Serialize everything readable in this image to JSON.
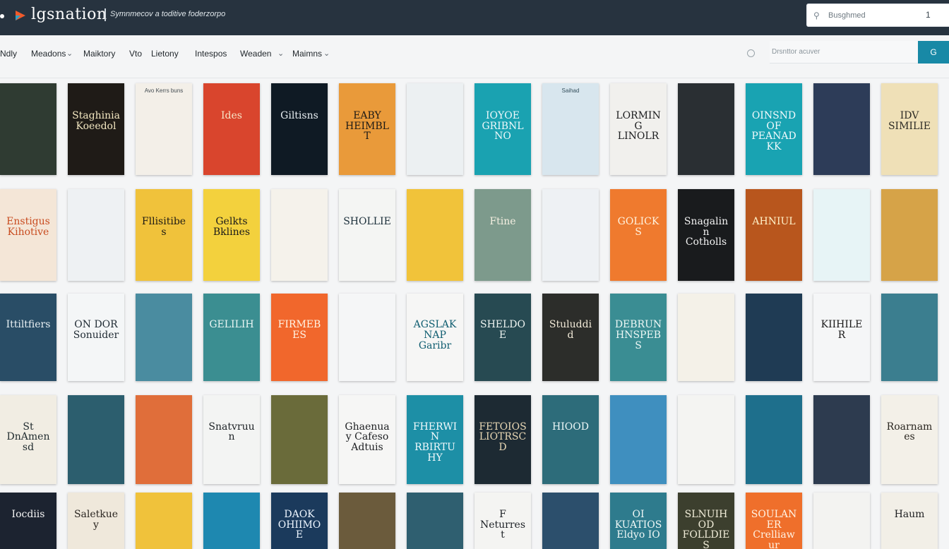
{
  "header": {
    "app_name": "lgsnation",
    "tagline": "Symnmecov a toditive foderzorpo",
    "search_text": "Busghmed",
    "search_count": "1",
    "colors": {
      "bar": "#27333f",
      "accent": "#1889a6"
    }
  },
  "nav": {
    "items": [
      "Ndly",
      "Meadons",
      "Maiktory",
      "Vto",
      "Lietony",
      "Intespos",
      "Weaden",
      "Maimns"
    ],
    "search_placeholder": "Drsnttor acuver",
    "search_button": "G"
  },
  "books": [
    {
      "top": "",
      "title": "",
      "bottom": "",
      "bg": "#2f3b32",
      "fg": "#e8e2c9"
    },
    {
      "top": "",
      "title": "Staghinia Koeedol",
      "bottom": "",
      "bg": "#1f1b17",
      "fg": "#f3e7c1"
    },
    {
      "top": "Avo Kerrs buns",
      "title": "",
      "bottom": "",
      "bg": "#f3efe8",
      "fg": "#1f2a33"
    },
    {
      "top": "",
      "title": "Ides",
      "bottom": "",
      "bg": "#d9452d",
      "fg": "#f7e6c8"
    },
    {
      "top": "",
      "title": "Giltisns",
      "bottom": "",
      "bg": "#0f1a24",
      "fg": "#e8eef2"
    },
    {
      "top": "",
      "title": "EABY HEIMBLT",
      "bottom": "",
      "bg": "#e99a3a",
      "fg": "#1d1a16"
    },
    {
      "top": "",
      "title": "",
      "bottom": "",
      "bg": "#ecf0f2",
      "fg": "#1f2b35"
    },
    {
      "top": "",
      "title": "IOYOE GRIBNLNO",
      "bottom": "",
      "bg": "#1aa2b1",
      "fg": "#eef8fa"
    },
    {
      "top": "Saihad",
      "title": "",
      "bottom": "",
      "bg": "#d8e6ee",
      "fg": "#13303e"
    },
    {
      "top": "",
      "title": "LORMING LINOLR",
      "bottom": "",
      "bg": "#f1f0ed",
      "fg": "#1b1c1e"
    },
    {
      "top": "",
      "title": "",
      "bottom": "",
      "bg": "#2a2f33",
      "fg": "#f0f0f0"
    },
    {
      "top": "",
      "title": "OINSND OF PEANADKK",
      "bottom": "",
      "bg": "#19a3b2",
      "fg": "#f2fafc"
    },
    {
      "top": "",
      "title": "",
      "bottom": "",
      "bg": "#2d3c58",
      "fg": "#f7d9a2"
    },
    {
      "top": "",
      "title": "IDV SIMILIE",
      "bottom": "",
      "bg": "#efe0b7",
      "fg": "#2c2a24"
    },
    {
      "top": "",
      "title": "Enstigus Kihotive",
      "bottom": "",
      "bg": "#f4e6d7",
      "fg": "#c84b1f"
    },
    {
      "top": "",
      "title": "",
      "bottom": "",
      "bg": "#eef1f3",
      "fg": "#1d2a33"
    },
    {
      "top": "",
      "title": "Fllisitibes",
      "bottom": "",
      "bg": "#f0c23b",
      "fg": "#1e1b14"
    },
    {
      "top": "",
      "title": "Gelkts Bklines",
      "bottom": "",
      "bg": "#f3d13d",
      "fg": "#1a1a1a"
    },
    {
      "top": "",
      "title": "",
      "bottom": "",
      "bg": "#f5f2eb",
      "fg": "#1d2833"
    },
    {
      "top": "",
      "title": "SHOLLIE",
      "bottom": "",
      "bg": "#f4f5f3",
      "fg": "#1a2e39"
    },
    {
      "top": "",
      "title": "",
      "bottom": "",
      "bg": "#f1c33a",
      "fg": "#1e2023"
    },
    {
      "top": "",
      "title": "Ftine",
      "bottom": "",
      "bg": "#7d9a8c",
      "fg": "#f6f0e2"
    },
    {
      "top": "",
      "title": "",
      "bottom": "",
      "bg": "#eef1f4",
      "fg": "#1d2a33"
    },
    {
      "top": "",
      "title": "GOLICKS",
      "bottom": "",
      "bg": "#ef7a2e",
      "fg": "#fff4e0"
    },
    {
      "top": "",
      "title": "Snagalinn Cotholls",
      "bottom": "",
      "bg": "#191b1d",
      "fg": "#f2f2f2"
    },
    {
      "top": "",
      "title": "AHNIUL",
      "bottom": "",
      "bg": "#b8561d",
      "fg": "#fff1c8"
    },
    {
      "top": "",
      "title": "",
      "bottom": "",
      "bg": "#e7f4f6",
      "fg": "#1a5f6e"
    },
    {
      "top": "",
      "title": "",
      "bottom": "",
      "bg": "#d6a348",
      "fg": "#2a2012"
    },
    {
      "top": "",
      "title": "Ittiltfiers",
      "bottom": "",
      "bg": "#294d66",
      "fg": "#e9f1f4"
    },
    {
      "top": "",
      "title": "ON DOR Sonuider",
      "bottom": "",
      "bg": "#f4f6f7",
      "fg": "#1f2a33"
    },
    {
      "top": "",
      "title": "",
      "bottom": "",
      "bg": "#4a8ca0",
      "fg": "#f1f6f7"
    },
    {
      "top": "",
      "title": "GELILIH",
      "bottom": "",
      "bg": "#3b8e91",
      "fg": "#eaf6f4"
    },
    {
      "top": "",
      "title": "FIRMEBES",
      "bottom": "",
      "bg": "#f1672c",
      "fg": "#fff5e6"
    },
    {
      "top": "",
      "title": "",
      "bottom": "",
      "bg": "#f5f6f7",
      "fg": "#1e2a33"
    },
    {
      "top": "",
      "title": "AGSLAKNAP Garibr",
      "bottom": "",
      "bg": "#f6f6f5",
      "fg": "#0f5d70"
    },
    {
      "top": "",
      "title": "SHELDOE",
      "bottom": "",
      "bg": "#274a52",
      "fg": "#eef4f1"
    },
    {
      "top": "",
      "title": "Stuluddid",
      "bottom": "",
      "bg": "#2c2d2a",
      "fg": "#f2ead8"
    },
    {
      "top": "",
      "title": "DEBRUN HNSPEBS",
      "bottom": "",
      "bg": "#3a8d93",
      "fg": "#eef8f6"
    },
    {
      "top": "",
      "title": "",
      "bottom": "",
      "bg": "#f4f1e8",
      "fg": "#2b2b26"
    },
    {
      "top": "",
      "title": "",
      "bottom": "",
      "bg": "#1f3b54",
      "fg": "#f6e3cf"
    },
    {
      "top": "",
      "title": "KIIHILER",
      "bottom": "",
      "bg": "#f5f6f7",
      "fg": "#1a1a1a"
    },
    {
      "top": "",
      "title": "",
      "bottom": "",
      "bg": "#3b7e8f",
      "fg": "#ecf5f6"
    },
    {
      "top": "",
      "title": "St DnAmensd",
      "bottom": "",
      "bg": "#f1ede3",
      "fg": "#1f2a2e"
    },
    {
      "top": "",
      "title": "",
      "bottom": "",
      "bg": "#2c5e6e",
      "fg": "#f2efe6"
    },
    {
      "top": "",
      "title": "",
      "bottom": "",
      "bg": "#e06e3a",
      "fg": "#fff3e2"
    },
    {
      "top": "",
      "title": "Snatvruun",
      "bottom": "",
      "bg": "#f3f4f3",
      "fg": "#1c2125"
    },
    {
      "top": "",
      "title": "",
      "bottom": "",
      "bg": "#6a6b3a",
      "fg": "#f6efd9"
    },
    {
      "top": "",
      "title": "Ghaenuay Cafeso Adtuis",
      "bottom": "",
      "bg": "#f6f6f5",
      "fg": "#1d1f22"
    },
    {
      "top": "",
      "title": "FHERWIN RBIRTUHY",
      "bottom": "",
      "bg": "#1d8fa6",
      "fg": "#f2fafc"
    },
    {
      "top": "",
      "title": "FETOIOS LIOTRSCD",
      "bottom": "",
      "bg": "#1d2a33",
      "fg": "#e9d8b5"
    },
    {
      "top": "",
      "title": "HIOOD",
      "bottom": "",
      "bg": "#2d6c7a",
      "fg": "#eef8f8"
    },
    {
      "top": "",
      "title": "",
      "bottom": "",
      "bg": "#3f8fbf",
      "fg": "#f2f8fc"
    },
    {
      "top": "",
      "title": "",
      "bottom": "",
      "bg": "#f4f4f2",
      "fg": "#1e1f21"
    },
    {
      "top": "",
      "title": "",
      "bottom": "",
      "bg": "#1e6f8c",
      "fg": "#f3fbff"
    },
    {
      "top": "",
      "title": "",
      "bottom": "",
      "bg": "#2d3b4f",
      "fg": "#f2e7c7"
    },
    {
      "top": "",
      "title": "Roarnames",
      "bottom": "",
      "bg": "#f3f0e8",
      "fg": "#2a2620"
    },
    {
      "top": "",
      "title": "Iocdiis",
      "bottom": "",
      "bg": "#1c2330",
      "fg": "#f5f5f5"
    },
    {
      "top": "",
      "title": "Saletkuey",
      "bottom": "",
      "bg": "#efe8db",
      "fg": "#2b2621"
    },
    {
      "top": "",
      "title": "",
      "bottom": "",
      "bg": "#f0c23b",
      "fg": "#1f1a12"
    },
    {
      "top": "",
      "title": "",
      "bottom": "",
      "bg": "#1e88b0",
      "fg": "#f2fbff"
    },
    {
      "top": "",
      "title": "DAOK OHIIMOE",
      "bottom": "",
      "bg": "#1b3a5c",
      "fg": "#eef6ff"
    },
    {
      "top": "",
      "title": "",
      "bottom": "",
      "bg": "#6b5b3c",
      "fg": "#f3eadb"
    },
    {
      "top": "",
      "title": "",
      "bottom": "",
      "bg": "#2f5f70",
      "fg": "#eef5f7"
    },
    {
      "top": "",
      "title": "F Neturrest",
      "bottom": "",
      "bg": "#f4f4f2",
      "fg": "#1d2126"
    },
    {
      "top": "",
      "title": "",
      "bottom": "",
      "bg": "#2c4f6c",
      "fg": "#f1eee5"
    },
    {
      "top": "",
      "title": "OI KUATIOS Eldyo IO",
      "bottom": "",
      "bg": "#2e7b8d",
      "fg": "#f0f8f6"
    },
    {
      "top": "",
      "title": "SLNUIHOD FOLLDIES",
      "bottom": "",
      "bg": "#3c3f2e",
      "fg": "#f0ecd8"
    },
    {
      "top": "",
      "title": "SOULANER Crelliawur",
      "bottom": "",
      "bg": "#ef6f2b",
      "fg": "#fff3e4"
    },
    {
      "top": "",
      "title": "",
      "bottom": "",
      "bg": "#f3f3f1",
      "fg": "#20262b"
    },
    {
      "top": "",
      "title": "Haum",
      "bottom": "",
      "bg": "#f2efe7",
      "fg": "#1e1f21"
    }
  ]
}
